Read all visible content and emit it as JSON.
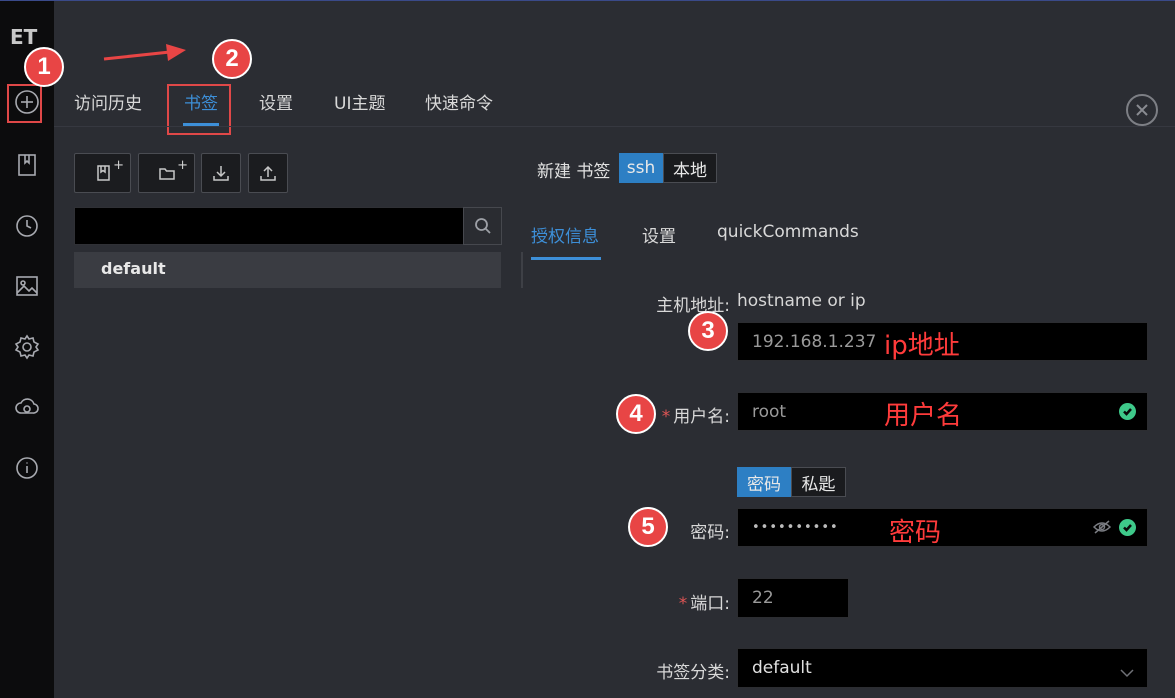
{
  "sidebar": {
    "logo": "ET",
    "icons": [
      "plus-circle-icon",
      "bookmark-icon",
      "clock-icon",
      "image-icon",
      "gear-icon",
      "cloud-sync-icon",
      "info-icon"
    ]
  },
  "annotations": {
    "badges": [
      "1",
      "2",
      "3",
      "4",
      "5"
    ],
    "ip_note": "ip地址",
    "user_note": "用户名",
    "pwd_note": "密码"
  },
  "tabs": [
    "访问历史",
    "书签",
    "设置",
    "UI主题",
    "快速命令"
  ],
  "active_tab": "书签",
  "toolbar": {
    "new_bookmark_sup": "+",
    "new_folder_sup": "+"
  },
  "search": {
    "placeholder": ""
  },
  "tree": {
    "items": [
      "default"
    ]
  },
  "new_bookmark": {
    "label": "新建 书签",
    "types": [
      "ssh",
      "本地"
    ],
    "selected": "ssh"
  },
  "subtabs": [
    "授权信息",
    "设置",
    "quickCommands"
  ],
  "form": {
    "host_label": "主机地址:",
    "host_hint": "hostname or ip",
    "host_value": "192.168.1.237",
    "user_label": "用户名:",
    "user_value": "root",
    "auth_types": [
      "密码",
      "私匙"
    ],
    "auth_selected": "密码",
    "pwd_label": "密码:",
    "pwd_value": "••••••••••",
    "port_label": "端口:",
    "port_value": "22",
    "category_label": "书签分类:",
    "category_value": "default"
  },
  "colors": {
    "accent": "#3d8fd8",
    "annotation": "#e84545",
    "success": "#3ec98a"
  }
}
